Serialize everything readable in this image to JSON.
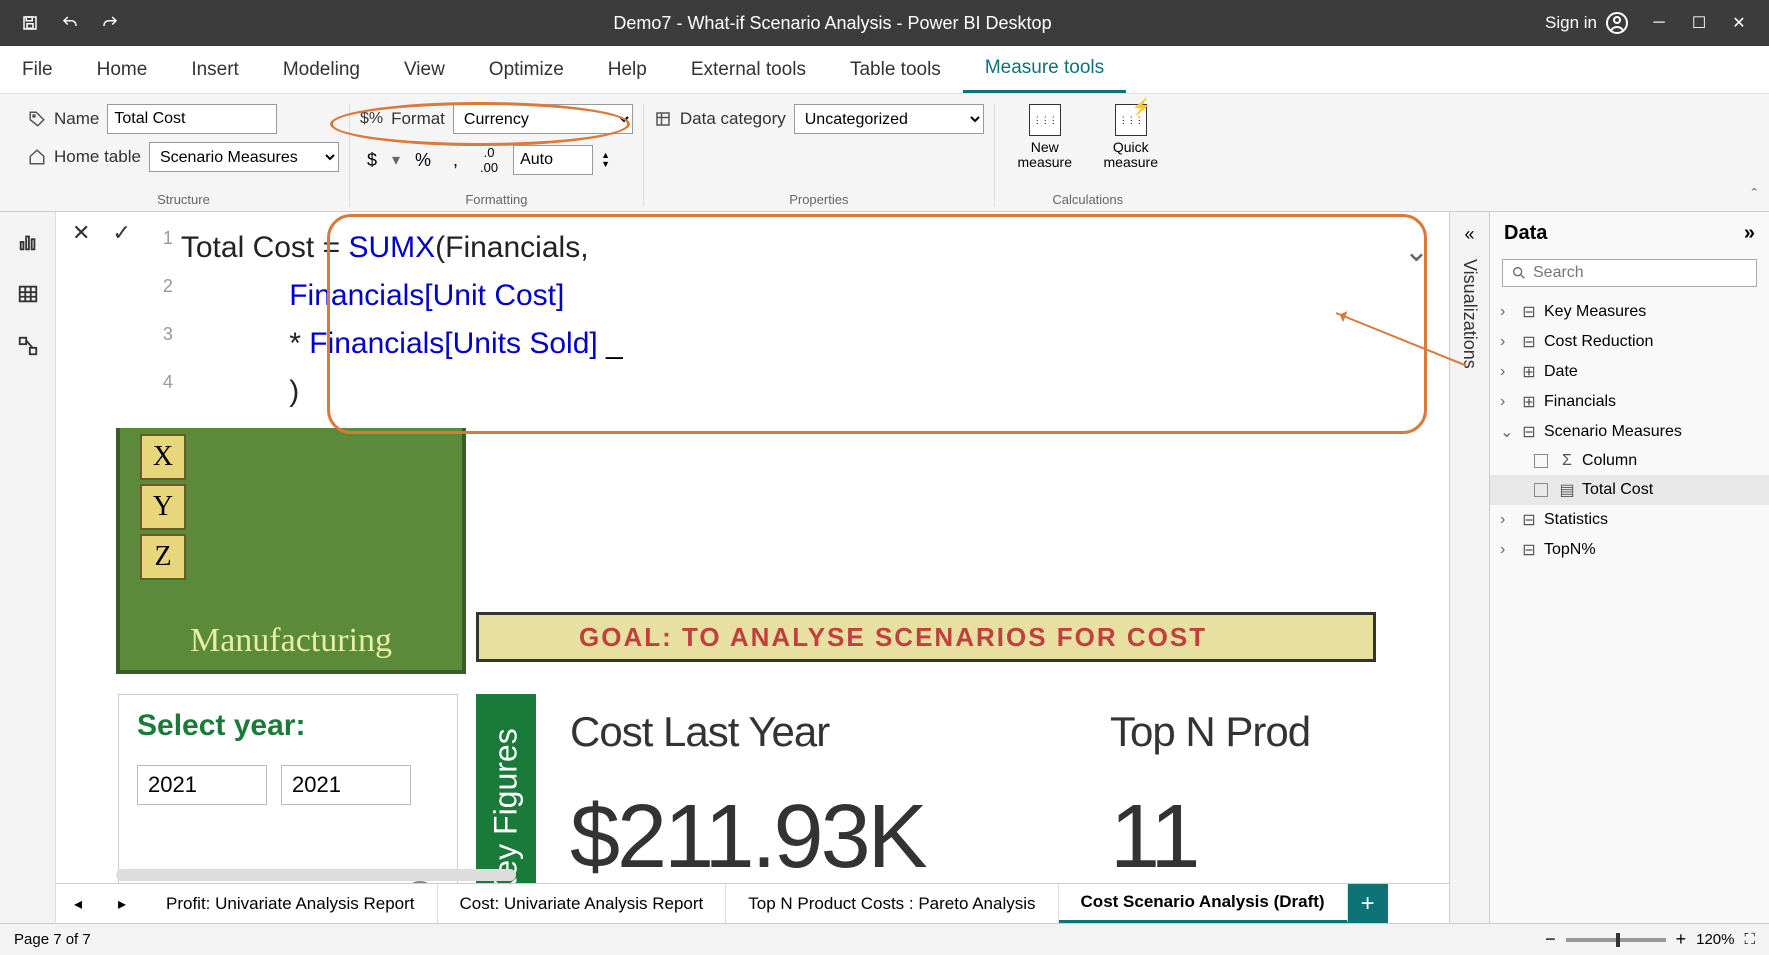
{
  "titlebar": {
    "title": "Demo7 - What-if Scenario Analysis - Power BI Desktop",
    "signin": "Sign in"
  },
  "ribbon_tabs": [
    "File",
    "Home",
    "Insert",
    "Modeling",
    "View",
    "Optimize",
    "Help",
    "External tools",
    "Table tools",
    "Measure tools"
  ],
  "active_tab": "Measure tools",
  "structure": {
    "name_label": "Name",
    "name_value": "Total Cost",
    "hometable_label": "Home table",
    "hometable_value": "Scenario Measures",
    "group_label": "Structure"
  },
  "formatting": {
    "format_label": "Format",
    "format_value": "Currency",
    "currency_btn": "$",
    "percent_btn": "%",
    "comma_btn": ",",
    "decimals_btn": ".00",
    "auto_value": "Auto",
    "group_label": "Formatting"
  },
  "properties": {
    "datacat_label": "Data category",
    "datacat_value": "Uncategorized",
    "group_label": "Properties"
  },
  "calculations": {
    "new_measure": "New measure",
    "quick_measure": "Quick measure",
    "group_label": "Calculations"
  },
  "formula": {
    "line1_pre": "Total Cost = ",
    "line1_fn": "SUMX",
    "line1_post": "(Financials,",
    "line2_pad": "             ",
    "line2_col": "Financials[Unit Cost]",
    "line3_pad": "             * ",
    "line3_col": "Financials[Units Sold]",
    "line3_cur": " _",
    "line4_pad": "             )",
    "gutter": [
      "1",
      "2",
      "3",
      "4"
    ]
  },
  "canvas": {
    "xyz": [
      "X",
      "Y",
      "Z"
    ],
    "manufacturing": "Manufacturing",
    "goal": "GOAL: TO ANALYSE SCENARIOS FOR COST",
    "select_year": "Select year:",
    "year_from": "2021",
    "year_to": "2021",
    "key_figures": "Key Figures",
    "card1_title": "Cost Last Year",
    "card1_value": "$211.93K",
    "card2_title": "Top N Prod",
    "card2_value": "11"
  },
  "page_tabs": [
    "Profit: Univariate Analysis Report",
    "Cost: Univariate Analysis Report",
    "Top N Product Costs : Pareto Analysis",
    "Cost Scenario Analysis (Draft)"
  ],
  "active_page": "Cost Scenario Analysis (Draft)",
  "viz_label": "Visualizations",
  "data_pane": {
    "header": "Data",
    "search_placeholder": "Search",
    "tables": [
      {
        "name": "Key Measures",
        "icon": "measure-group",
        "expanded": false
      },
      {
        "name": "Cost Reduction",
        "icon": "measure-group",
        "expanded": false
      },
      {
        "name": "Date",
        "icon": "table",
        "expanded": false
      },
      {
        "name": "Financials",
        "icon": "table",
        "expanded": false
      },
      {
        "name": "Scenario Measures",
        "icon": "measure-group",
        "expanded": true,
        "children": [
          {
            "name": "Column",
            "icon": "sigma"
          },
          {
            "name": "Total Cost",
            "icon": "measure",
            "selected": true
          }
        ]
      },
      {
        "name": "Statistics",
        "icon": "measure-group",
        "expanded": false
      },
      {
        "name": "TopN%",
        "icon": "measure-group",
        "expanded": false
      }
    ]
  },
  "statusbar": {
    "page": "Page 7 of 7",
    "zoom_minus": "−",
    "zoom_plus": "+",
    "zoom_value": "120%"
  }
}
